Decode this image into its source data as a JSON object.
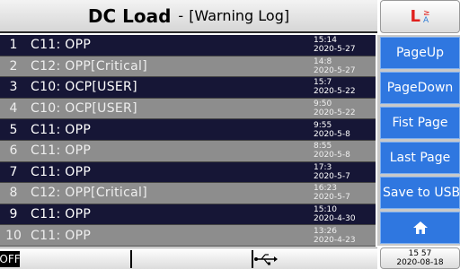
{
  "header": {
    "title": "DC Load",
    "separator": "-",
    "subtitle": "[Warning Log]"
  },
  "logo": {
    "mark": "L",
    "glyph_top": "≥",
    "glyph_bottom": "A"
  },
  "log_entries": [
    {
      "index": "1",
      "message": "C11: OPP",
      "time": "15:14",
      "date": "2020-5-27"
    },
    {
      "index": "2",
      "message": "C12: OPP[Critical]",
      "time": "14:8",
      "date": "2020-5-27"
    },
    {
      "index": "3",
      "message": "C10: OCP[USER]",
      "time": "15:7",
      "date": "2020-5-22"
    },
    {
      "index": "4",
      "message": "C10: OCP[USER]",
      "time": "9:50",
      "date": "2020-5-22"
    },
    {
      "index": "5",
      "message": "C11: OPP",
      "time": "9:55",
      "date": "2020-5-8"
    },
    {
      "index": "6",
      "message": "C11: OPP",
      "time": "8:55",
      "date": "2020-5-8"
    },
    {
      "index": "7",
      "message": "C11: OPP",
      "time": "17:3",
      "date": "2020-5-7"
    },
    {
      "index": "8",
      "message": "C12: OPP[Critical]",
      "time": "16:23",
      "date": "2020-5-7"
    },
    {
      "index": "9",
      "message": "C11: OPP",
      "time": "15:10",
      "date": "2020-4-30"
    },
    {
      "index": "10",
      "message": "C11: OPP",
      "time": "13:26",
      "date": "2020-4-23"
    }
  ],
  "buttons": {
    "page_up": "PageUp",
    "page_down": "PageDown",
    "first_page": "Fist Page",
    "last_page": "Last Page",
    "save_to_usb": "Save to USB",
    "home_icon": "home-icon"
  },
  "status": {
    "output_state": "OFF",
    "usb_icon": "usb-icon",
    "clock_time": "15 57",
    "clock_date": "2020-08-18"
  },
  "colors": {
    "button_blue": "#2f77e0",
    "row_dark": "#161636",
    "row_light": "#8d8d8d",
    "logo_red": "#e0201d"
  }
}
